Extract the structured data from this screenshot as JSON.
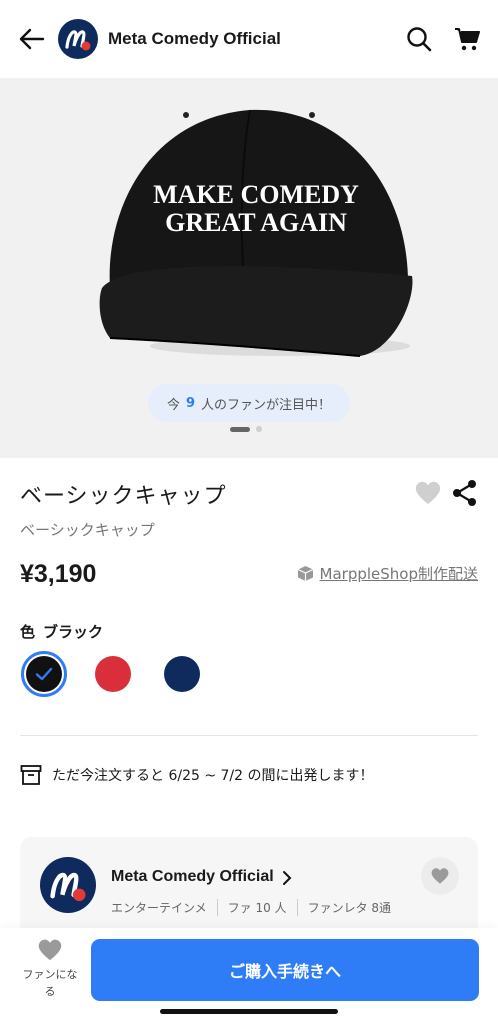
{
  "header": {
    "shop_name": "Meta Comedy Official",
    "icons": [
      "back-arrow-icon",
      "search-icon",
      "cart-icon"
    ]
  },
  "hero": {
    "cap_line1": "MAKE COMEDY",
    "cap_line2": "GREAT AGAIN",
    "watch_prefix": "今",
    "watch_count": "9",
    "watch_suffix": "人のファンが注目中！",
    "carousel_pages": 2,
    "carousel_active": 1
  },
  "product": {
    "title": "ベーシックキャップ",
    "subtitle": "ベーシックキャップ",
    "price": "¥3,190",
    "shipping_label": "MarppleShop制作配送",
    "color_label": "色",
    "color_selected": "ブラック",
    "colors": [
      {
        "name": "black",
        "hex": "#111111",
        "selected": true
      },
      {
        "name": "red",
        "hex": "#d92f3a",
        "selected": false
      },
      {
        "name": "navy",
        "hex": "#0f2a5c",
        "selected": false
      }
    ],
    "ship_note": "ただ今注文すると 6/25 ~ 7/2 の間に出発します！"
  },
  "shop_card": {
    "name": "Meta Comedy Official",
    "stats": [
      "エンターテインメ",
      "ファ 10 人",
      "ファンレタ 8通"
    ]
  },
  "bottom": {
    "fan_label_line1": "ファンにな",
    "fan_label_line2": "る",
    "buy_label": "ご購入手続きへ"
  },
  "colors": {
    "accent": "#2f7df6",
    "brand_navy": "#0f2a5c",
    "brand_red": "#e23a36"
  }
}
